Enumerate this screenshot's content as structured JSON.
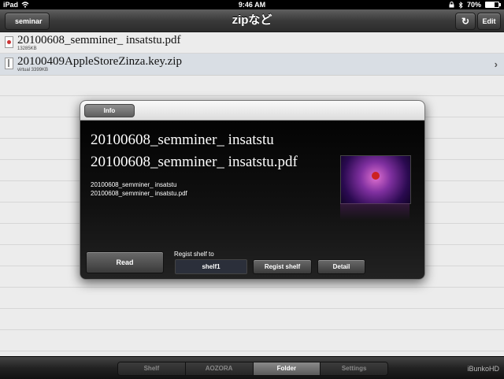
{
  "status_bar": {
    "device": "iPad",
    "time": "9:46 AM",
    "battery": "70%",
    "battery_level": 0.7
  },
  "navbar": {
    "back_label": "seminar",
    "title": "zipなど",
    "refresh_glyph": "↻",
    "edit_label": "Edit"
  },
  "files": [
    {
      "name": "20100608_semminer_ insatstu.pdf",
      "size": "13285KB",
      "type": "pdf",
      "selected": false
    },
    {
      "name": "20100409AppleStoreZinza.key.zip",
      "size": "virtual 3399KB",
      "type": "zip",
      "selected": true,
      "chevron": "›"
    }
  ],
  "modal": {
    "tab_label": "Info",
    "title_line1": "20100608_semminer_ insatstu",
    "title_line2": "20100608_semminer_ insatstu.pdf",
    "detail_line1": "20100608_semminer_ insatstu",
    "detail_line2": "20100608_semminer_ insatstu.pdf",
    "read_label": "Read",
    "regist_shelf_to_label": "Regist shelf to",
    "shelf_value": "shelf1",
    "regist_shelf_label": "Regist shelf",
    "detail_label": "Detail"
  },
  "tabbar": {
    "tabs": [
      "Shelf",
      "AOZORA",
      "Folder",
      "Settings"
    ],
    "active": "Folder",
    "brand": "iBunkoHD"
  },
  "icons": [
    "wifi-icon",
    "lock-icon",
    "bluetooth-icon",
    "battery-icon",
    "refresh-icon",
    "pdf-file-icon",
    "zip-file-icon",
    "chevron-right-icon"
  ]
}
